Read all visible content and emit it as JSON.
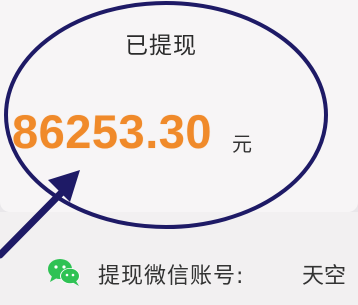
{
  "card": {
    "title": "已提现",
    "amount": "86253.30",
    "unit": "元"
  },
  "wechat": {
    "icon": "wechat-icon",
    "label": "提现微信账号:",
    "value": "天空"
  },
  "colors": {
    "amount": "#f08a2a",
    "annotation": "#1e1a66",
    "wechat_green": "#2fc254"
  }
}
